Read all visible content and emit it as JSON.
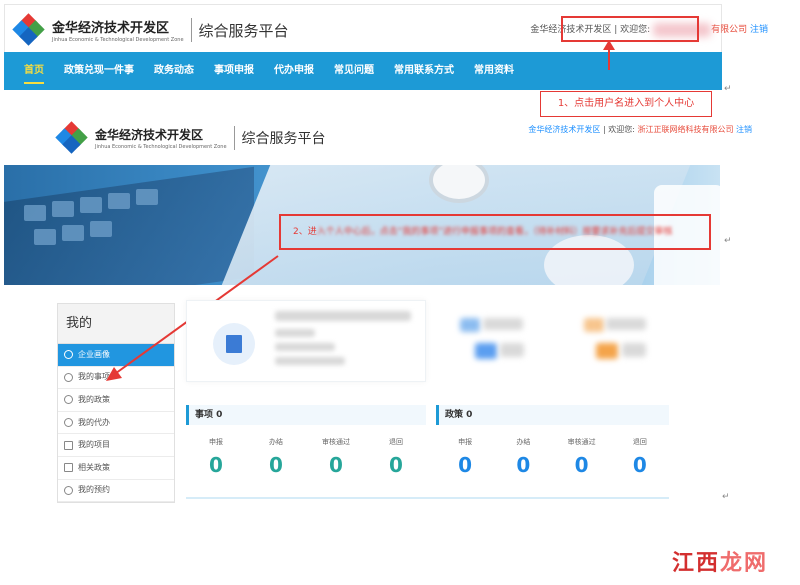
{
  "top": {
    "brand_cn": "金华经济技术开发区",
    "brand_en": "Jinhua Economic & Technological Development Zone",
    "platform": "综合服务平台",
    "login_area": "金华经济技术开发区",
    "welcome": "欢迎您:",
    "company_suffix": "有限公司",
    "logout": "注销"
  },
  "nav": {
    "items": [
      {
        "label": "首页",
        "active": true
      },
      {
        "label": "政策兑现一件事",
        "active": false
      },
      {
        "label": "政务动态",
        "active": false
      },
      {
        "label": "事项申报",
        "active": false
      },
      {
        "label": "代办申报",
        "active": false
      },
      {
        "label": "常见问题",
        "active": false
      },
      {
        "label": "常用联系方式",
        "active": false
      },
      {
        "label": "常用资料",
        "active": false
      }
    ]
  },
  "annotation1": "1、点击用户名进入到个人中心",
  "second": {
    "brand_cn": "金华经济技术开发区",
    "brand_en": "Jinhua Economic & Technological Development Zone",
    "platform": "综合服务平台",
    "login_area": "金华经济技术开发区",
    "welcome": "欢迎您:",
    "company": "浙江正联网络科技有限公司",
    "logout": "注销"
  },
  "annotation2_prefix": "2、进",
  "annotation2_blurred": "入个人中心后，点击“我的事项”进行申报事项的查看，（待补材料）按要求补充后提交审核",
  "sidebar": {
    "title": "我的",
    "items": [
      {
        "label": "企业画像",
        "active": true,
        "icon": "chart-icon"
      },
      {
        "label": "我的事项",
        "active": false,
        "icon": "edit-icon"
      },
      {
        "label": "我的政策",
        "active": false,
        "icon": "edit-icon"
      },
      {
        "label": "我的代办",
        "active": false,
        "icon": "edit-icon"
      },
      {
        "label": "我的项目",
        "active": false,
        "icon": "list-icon"
      },
      {
        "label": "相关政策",
        "active": false,
        "icon": "doc-icon"
      },
      {
        "label": "我的预约",
        "active": false,
        "icon": "clock-icon"
      }
    ]
  },
  "stats": {
    "items_panel": {
      "title": "事项 0",
      "cols": [
        {
          "label": "申报",
          "value": "0"
        },
        {
          "label": "办结",
          "value": "0"
        },
        {
          "label": "审核通过",
          "value": "0"
        },
        {
          "label": "退回",
          "value": "0"
        }
      ]
    },
    "policy_panel": {
      "title": "政策 0",
      "cols": [
        {
          "label": "申报",
          "value": "0"
        },
        {
          "label": "办结",
          "value": "0"
        },
        {
          "label": "审核通过",
          "value": "0"
        },
        {
          "label": "退回",
          "value": "0"
        }
      ]
    }
  },
  "watermark": {
    "part1": "江西",
    "part2": "龙网"
  },
  "colors": {
    "nav_bg": "#1d9ad6",
    "nav_active": "#f7dd40",
    "annotation": "#e53935",
    "items_value": "#26a69a",
    "policy_value": "#1e88e5"
  }
}
